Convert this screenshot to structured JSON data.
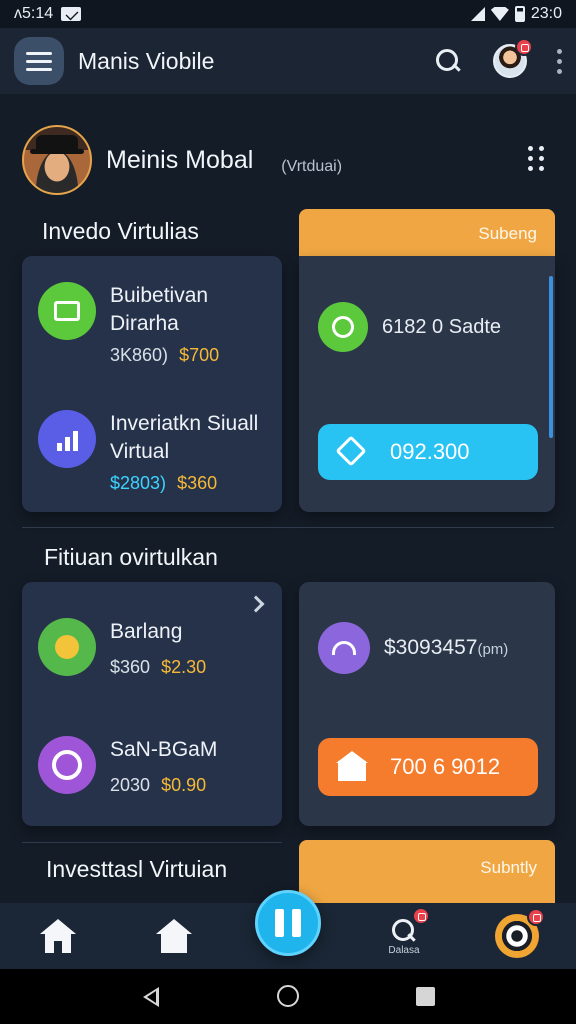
{
  "status_bar": {
    "time": "ᴧ5:14",
    "right_time": "23:0"
  },
  "app_bar": {
    "title": "Manis Viobile"
  },
  "profile": {
    "name": "Meinis Mobal",
    "tag": "(Vrtduai)"
  },
  "section1": {
    "title": "Invedo Virtulias",
    "right_header": "Subeng",
    "items": [
      {
        "title": "Buibetivan",
        "subtitle": "Dirarha",
        "price_a": "3K860)",
        "price_b": "$700",
        "icon": "document-icon",
        "color": "#5cc93d"
      },
      {
        "title": "Inveriatkn Siuall",
        "subtitle": "Virtual",
        "price_a": "$2803)",
        "price_b": "$360",
        "icon": "chart-icon",
        "color": "#5a5ee6"
      }
    ],
    "right_item": {
      "label": "6182 0 Sadte",
      "icon": "coin-icon",
      "color": "#5cc93d"
    },
    "right_pill": {
      "label": "092.300",
      "icon": "tag-icon",
      "color": "#29c3f3"
    }
  },
  "section2": {
    "title": "Fitiuan ovirtulkan",
    "items": [
      {
        "title": "Barlang",
        "price_a": "$360",
        "price_b": "$2.30",
        "icon": "flower-icon",
        "color": "#55b84a"
      },
      {
        "title": "SaN-BGaM",
        "price_a": "2030",
        "price_b": "$0.90",
        "icon": "swap-icon",
        "color": "#9e55d8"
      }
    ],
    "right_item": {
      "label": "$3093457",
      "unit": "pm",
      "icon": "wifi-coin-icon",
      "color": "#8b66dd"
    },
    "right_pill": {
      "label": "700 6 9012",
      "icon": "house-icon",
      "color": "#f47c2c"
    }
  },
  "section3": {
    "title": "Investtasl Virtuian",
    "right_header": "Subntly"
  },
  "bottom_nav": {
    "search_label": "Dalasa"
  }
}
